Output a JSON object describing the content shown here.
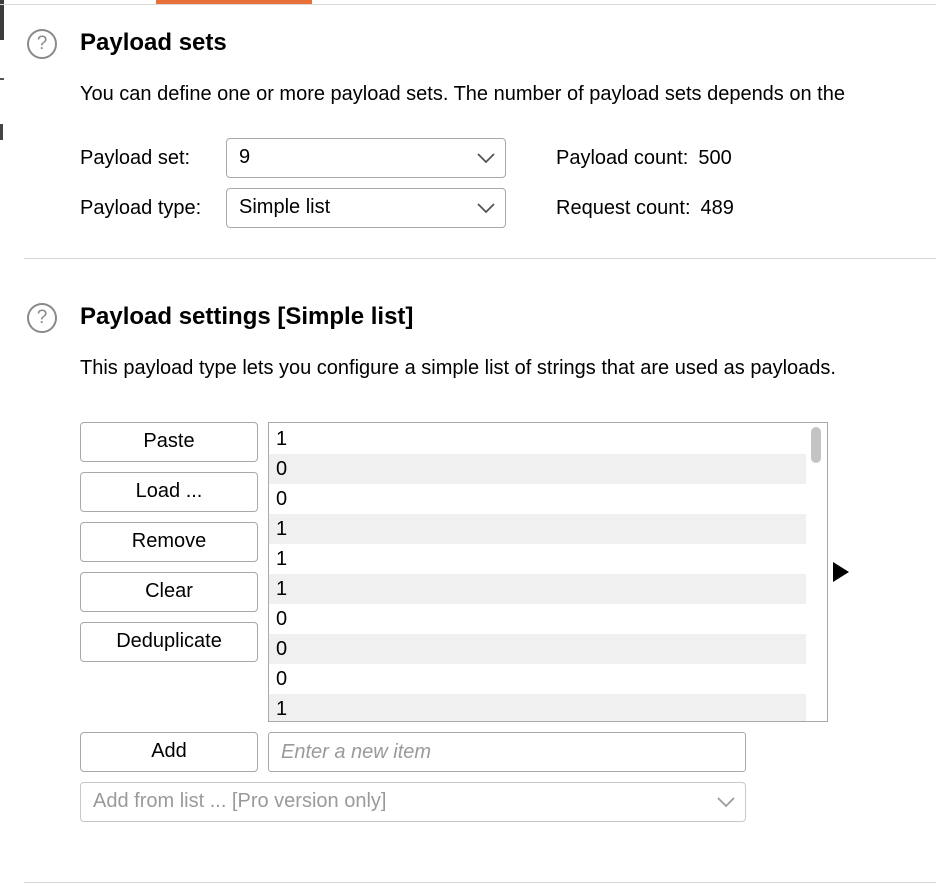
{
  "payload_sets": {
    "title": "Payload sets",
    "help_glyph": "?",
    "description": "You can define one or more payload sets. The number of payload sets depends on the",
    "set_label": "Payload set:",
    "set_value": "9",
    "type_label": "Payload type:",
    "type_value": "Simple list",
    "payload_count_label": "Payload count:",
    "payload_count_value": "500",
    "request_count_label": "Request count:",
    "request_count_value": "489"
  },
  "payload_settings": {
    "title": "Payload settings [Simple list]",
    "help_glyph": "?",
    "description": "This payload type lets you configure a simple list of strings that are used as payloads.",
    "buttons": {
      "paste": "Paste",
      "load": "Load ...",
      "remove": "Remove",
      "clear": "Clear",
      "deduplicate": "Deduplicate",
      "add": "Add"
    },
    "list_items": [
      "1",
      "0",
      "0",
      "1",
      "1",
      "1",
      "0",
      "0",
      "0",
      "1"
    ],
    "new_item_placeholder": "Enter a new item",
    "add_from_list": "Add from list ... [Pro version only]"
  },
  "colors": {
    "accent_tab": "#e8713a",
    "alt_row": "#f0f0f0"
  },
  "icons": [
    "help-icon",
    "chevron-down-icon",
    "expand-arrow-icon"
  ]
}
